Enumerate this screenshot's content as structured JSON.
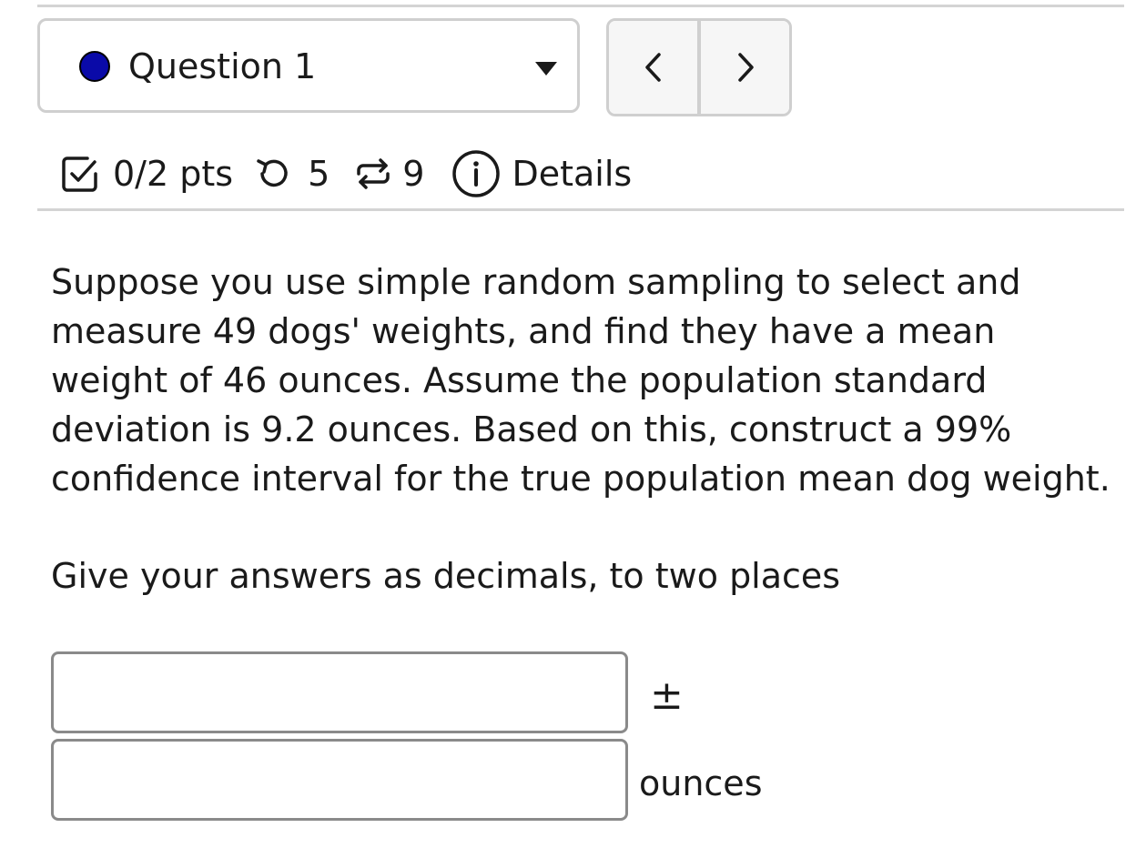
{
  "question_nav": {
    "selected_question": "Question 1",
    "status_color": "#0a0aa8",
    "prev_icon": "chevron-left-icon",
    "next_icon": "chevron-right-icon"
  },
  "meta": {
    "points": "0/2 pts",
    "retries": "5",
    "submissions": "9",
    "details_label": "Details",
    "points_icon": "checkbox-icon",
    "retries_icon": "undo-icon",
    "submissions_icon": "repeat-icon",
    "details_icon": "info-icon"
  },
  "question": {
    "text": "Suppose you use simple random sampling to select and measure 49 dogs' weights, and find they have a mean weight of 46 ounces. Assume the population standard deviation is 9.2 ounces. Based on this, construct a 99% confidence interval for the true population mean dog weight.",
    "instructions": "Give your answers as decimals, to two places"
  },
  "answer": {
    "estimate_value": "",
    "margin_value": "",
    "pm_symbol": "±",
    "unit": "ounces"
  }
}
